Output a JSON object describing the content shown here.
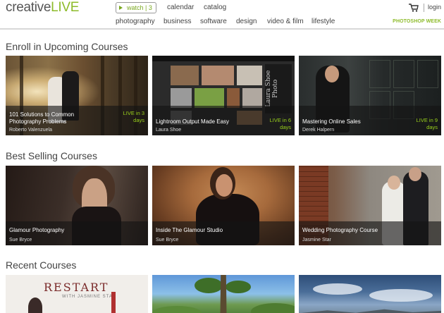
{
  "header": {
    "logo_part1": "creative",
    "logo_part2": "LIVE",
    "watch_label": "watch | 3",
    "top_links": [
      "calendar",
      "catalog"
    ],
    "nav_links": [
      "photography",
      "business",
      "software",
      "design",
      "video & film",
      "lifestyle"
    ],
    "login_label": "login",
    "promo_label": "PHOTOSHOP WEEK"
  },
  "sections": {
    "upcoming": {
      "title": "Enroll in Upcoming Courses",
      "courses": [
        {
          "title": "101 Solutions to Common Photography Problems",
          "author": "Roberto Valenzuela",
          "live": "LIVE in 3 days"
        },
        {
          "title": "Lightroom Output Made Easy",
          "author": "Laura Shoe",
          "live": "LIVE in 6 days"
        },
        {
          "title": "Mastering Online Sales",
          "author": "Derek Halpern",
          "live": "LIVE in 9 days"
        }
      ]
    },
    "best_selling": {
      "title": "Best Selling Courses",
      "courses": [
        {
          "title": "Glamour Photography",
          "author": "Sue Bryce"
        },
        {
          "title": "Inside The Glamour Studio",
          "author": "Sue Bryce"
        },
        {
          "title": "Wedding Photography Course",
          "author": "Jasmine Star"
        }
      ]
    },
    "recent": {
      "title": "Recent Courses",
      "image_text": "RESTART",
      "image_subtext": "WITH JASMINE STAR"
    }
  },
  "lightroom_panel_text": "Laura Shoe Photo"
}
